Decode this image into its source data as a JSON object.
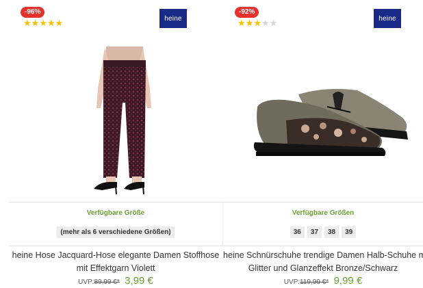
{
  "products": [
    {
      "discount_badge": "-96%",
      "rating": 5,
      "rating_max": 5,
      "brand_logo": "heine",
      "image_icon": "trousers-image",
      "sizes_heading": "Verfügbare Größe",
      "sizes_note": "(mehr als 6 verschiedene Größen)",
      "title_line1": "heine Hose Jacquard-Hose elegante Damen Stoffhose",
      "title_line2": "mit Effektgarn Violett",
      "uvp_label": "UVP:",
      "old_price": "89,99 €*",
      "new_price": "3,99 €"
    },
    {
      "discount_badge": "-92%",
      "rating": 3,
      "rating_max": 5,
      "brand_logo": "heine",
      "image_icon": "shoe-image",
      "sizes_heading": "Verfügbare Größen",
      "sizes": [
        "36",
        "37",
        "38",
        "39"
      ],
      "title_line1": "heine Schnürschuhe trendige Damen Halb-Schuhe mit",
      "title_line2": "Glitter und Glanzeffekt Bronze/Schwarz",
      "uvp_label": "UVP:",
      "old_price": "119,99 €*",
      "new_price": "9,99 €"
    }
  ],
  "colors": {
    "badge": "#e5322d",
    "star": "#f2c200",
    "brand": "#1a2b87",
    "price": "#6aa033"
  }
}
